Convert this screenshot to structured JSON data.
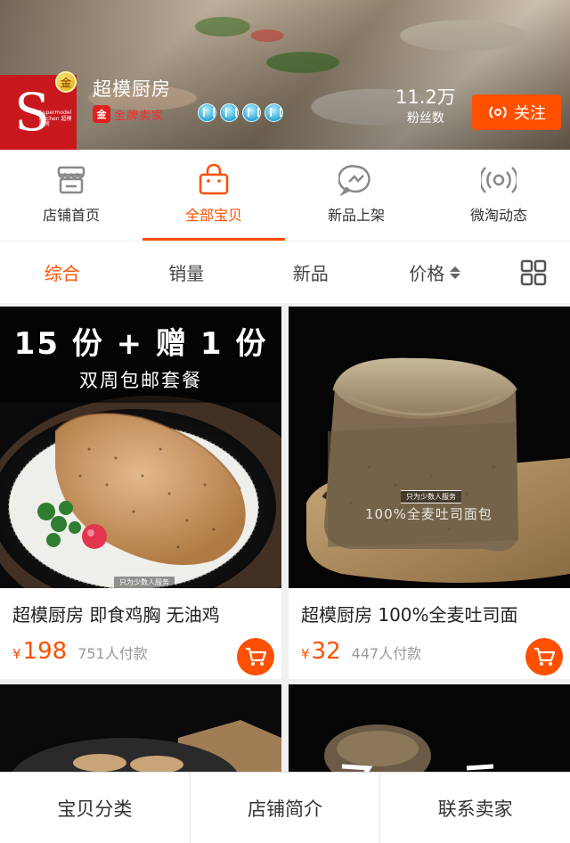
{
  "shop": {
    "name": "超模厨房",
    "logo_letter": "S",
    "logo_text": "Supermodel Kitchen 超模厨房",
    "medal_char": "金",
    "badge_char": "金",
    "badge_label": "金牌卖家",
    "fans_count": "11.2万",
    "fans_label": "粉丝数",
    "follow_label": "关注"
  },
  "nav": {
    "items": [
      {
        "label": "店铺首页",
        "icon": "store-icon"
      },
      {
        "label": "全部宝贝",
        "icon": "shopping-bag-icon",
        "active": true
      },
      {
        "label": "新品上架",
        "icon": "new-arrival-icon"
      },
      {
        "label": "微淘动态",
        "icon": "broadcast-icon"
      }
    ]
  },
  "sort": {
    "items": [
      "综合",
      "销量",
      "新品",
      "价格"
    ],
    "active_index": 0,
    "view_toggle_icon": "grid-view-icon"
  },
  "products": [
    {
      "title": "超模厨房 即食鸡胸 无油鸡",
      "currency": "¥",
      "price": "198",
      "sold": "751人付款",
      "promo_main": "15 份 + 赠 1 份",
      "promo_sub": "双周包邮套餐",
      "tag_note": "只为少数人服务"
    },
    {
      "title": "超模厨房 100%全麦吐司面",
      "currency": "¥",
      "price": "32",
      "sold": "447人付款",
      "overlay_text": "100%全麦吐司面包",
      "tag_note": "只为少数人服务"
    }
  ],
  "bottom_bar": {
    "items": [
      "宝贝分类",
      "店铺简介",
      "联系卖家"
    ]
  },
  "colors": {
    "accent": "#ff5000",
    "logo_red": "#c9171e",
    "crown_blue": "#2aa6d8"
  }
}
